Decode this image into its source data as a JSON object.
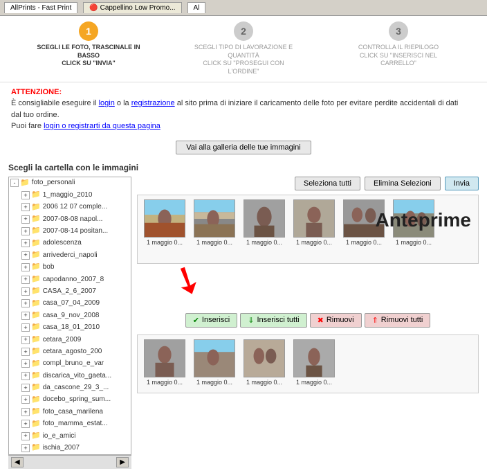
{
  "browser": {
    "tab1_label": "AllPrints - Fast Print",
    "tab2_label": "Cappellino Low Promo...",
    "tab3_label": "Al"
  },
  "steps": {
    "step1": {
      "number": "1",
      "label": "SCEGLI LE FOTO, TRASCINALE IN BASSO\nCLICK SU \"INVIA\"",
      "active": true
    },
    "step2": {
      "number": "2",
      "label": "SCEGLI TIPO DI LAVORAZIONE E QUANTITÀ\nCLICK SU \"PROSEGUI CON L'ORDINE\"",
      "active": false
    },
    "step3": {
      "number": "3",
      "label": "CONTROLLA IL RIEPILOGO\nCLICK SU \"INSERISCI NEL CARRELLO\"",
      "active": false
    }
  },
  "attention": {
    "title": "ATTENZIONE:",
    "line1_pre": "È consigliabile eseguire il ",
    "link1": "login",
    "line1_mid": " o la ",
    "link2": "registrazione",
    "line1_post": " al sito prima di iniziare il caricamento delle foto per evitare perdite accidentali di dati",
    "line2": "dal tuo ordine.",
    "line3_pre": "Puoi fare ",
    "link3": "login o registrarti da questa pagina",
    "gallery_button": "Vai alla galleria delle tue immagini"
  },
  "folder_section": {
    "title": "Scegli la cartella con le immagini"
  },
  "tree": {
    "root": "foto_personali",
    "items": [
      "1_maggio_2010",
      "2006 12 07 comple...",
      "2007-08-08 napol...",
      "2007-08-14 positan...",
      "adolescenza",
      "arrivederci_napoli",
      "bob",
      "capodanno_2007_8",
      "CASA_2_6_2007",
      "casa_07_04_2009",
      "casa_9_nov_2008",
      "casa_18_01_2010",
      "cetara_2009",
      "cetara_agosto_200",
      "compl_bruno_e_var",
      "discarica_vito_gaeta...",
      "da_cascone_29_3_...",
      "docebo_spring_sum...",
      "foto_casa_marilena",
      "foto_mamma_estat...",
      "io_e_amici",
      "ischia_2007"
    ]
  },
  "buttons": {
    "seleziona_tutti": "Seleziona tutti",
    "elimina_selezioni": "Elimina Selezioni",
    "invia": "Invia",
    "inserisci": "Inserisci",
    "inserisci_tutti": "Inserisci tutti",
    "rimuovi": "Rimuovi",
    "rimuovi_tutti": "Rimuovi tutti"
  },
  "thumbnails_top": [
    {
      "label": "1 maggio 0..."
    },
    {
      "label": "1 maggio 0..."
    },
    {
      "label": "1 maggio 0..."
    },
    {
      "label": "1 maggio 0..."
    },
    {
      "label": "1 maggio 0..."
    },
    {
      "label": "1 maggio 0..."
    }
  ],
  "thumbnails_bottom": [
    {
      "label": "1 maggio 0..."
    },
    {
      "label": "1 maggio 0..."
    },
    {
      "label": "1 maggio 0..."
    },
    {
      "label": "1 maggio 0..."
    }
  ],
  "anteprime_label": "Anteprime"
}
